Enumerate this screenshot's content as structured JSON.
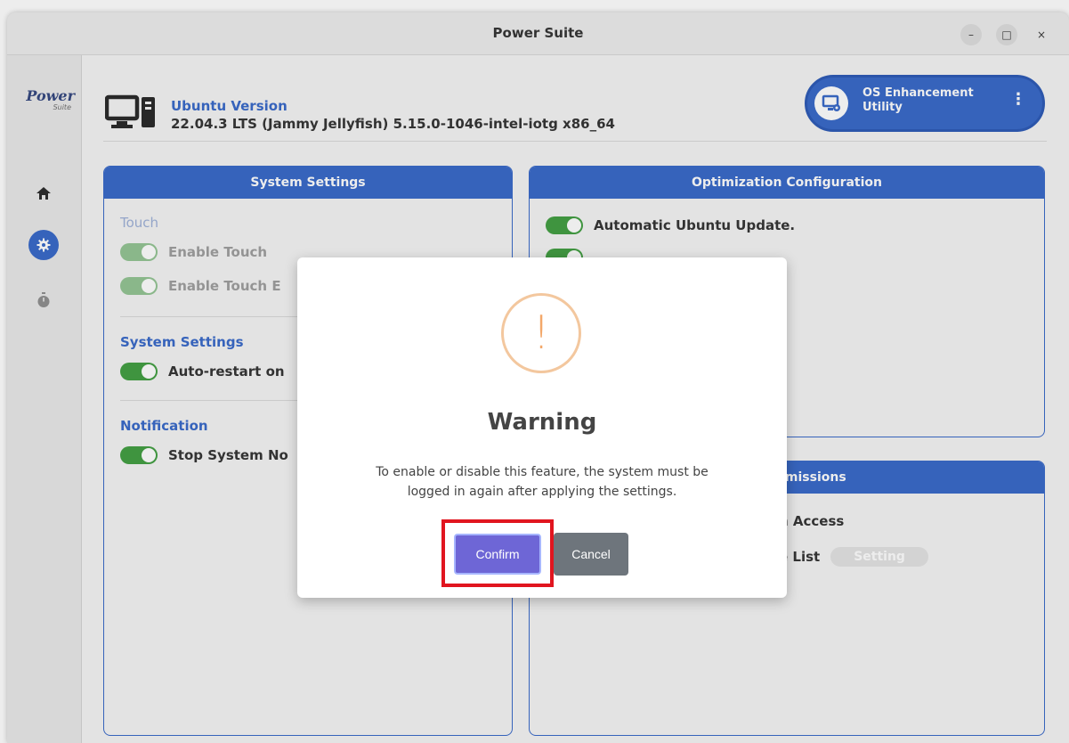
{
  "window": {
    "title": "Power Suite",
    "controls": {
      "minimize": "–",
      "maximize": "□",
      "close": "×"
    }
  },
  "sidebar": {
    "logo_main": "Power",
    "logo_sub": "Suite",
    "items": [
      {
        "icon": "home-icon",
        "active": false
      },
      {
        "icon": "gear-icon",
        "active": true
      },
      {
        "icon": "stopwatch-icon",
        "active": false
      }
    ]
  },
  "header": {
    "version_label": "Ubuntu Version",
    "version_value": "22.04.3 LTS (Jammy Jellyfish) 5.15.0-1046-intel-iotg x86_64",
    "utility_line1": "OS Enhancement",
    "utility_line2": "Utility",
    "utility_menu": "⋮"
  },
  "system_settings_panel": {
    "title": "System Settings",
    "touch_title": "Touch",
    "enable_touch": "Enable Touch",
    "enable_touch_e": "Enable Touch E",
    "system_settings_title": "System Settings",
    "auto_restart": "Auto-restart on",
    "notification_title": "Notification",
    "stop_system": "Stop System No"
  },
  "optimization_panel": {
    "title": "Optimization Configuration",
    "auto_update": "Automatic Ubuntu Update."
  },
  "permissions_panel": {
    "title_partial": "rmissions",
    "access_partial": "n Access",
    "list_partial": "e List",
    "setting_button": "Setting"
  },
  "dialog": {
    "icon_glyph": "!",
    "title": "Warning",
    "message_line1": "To enable or disable this feature, the system must be",
    "message_line2": "logged in again after applying the settings.",
    "confirm": "Confirm",
    "cancel": "Cancel"
  },
  "colors": {
    "accent": "#2f62c7",
    "toggle_on": "#3a9a3a",
    "confirm": "#6e66d6",
    "cancel": "#6e757c",
    "warning": "#f3a86a",
    "highlight": "#e1151f"
  }
}
